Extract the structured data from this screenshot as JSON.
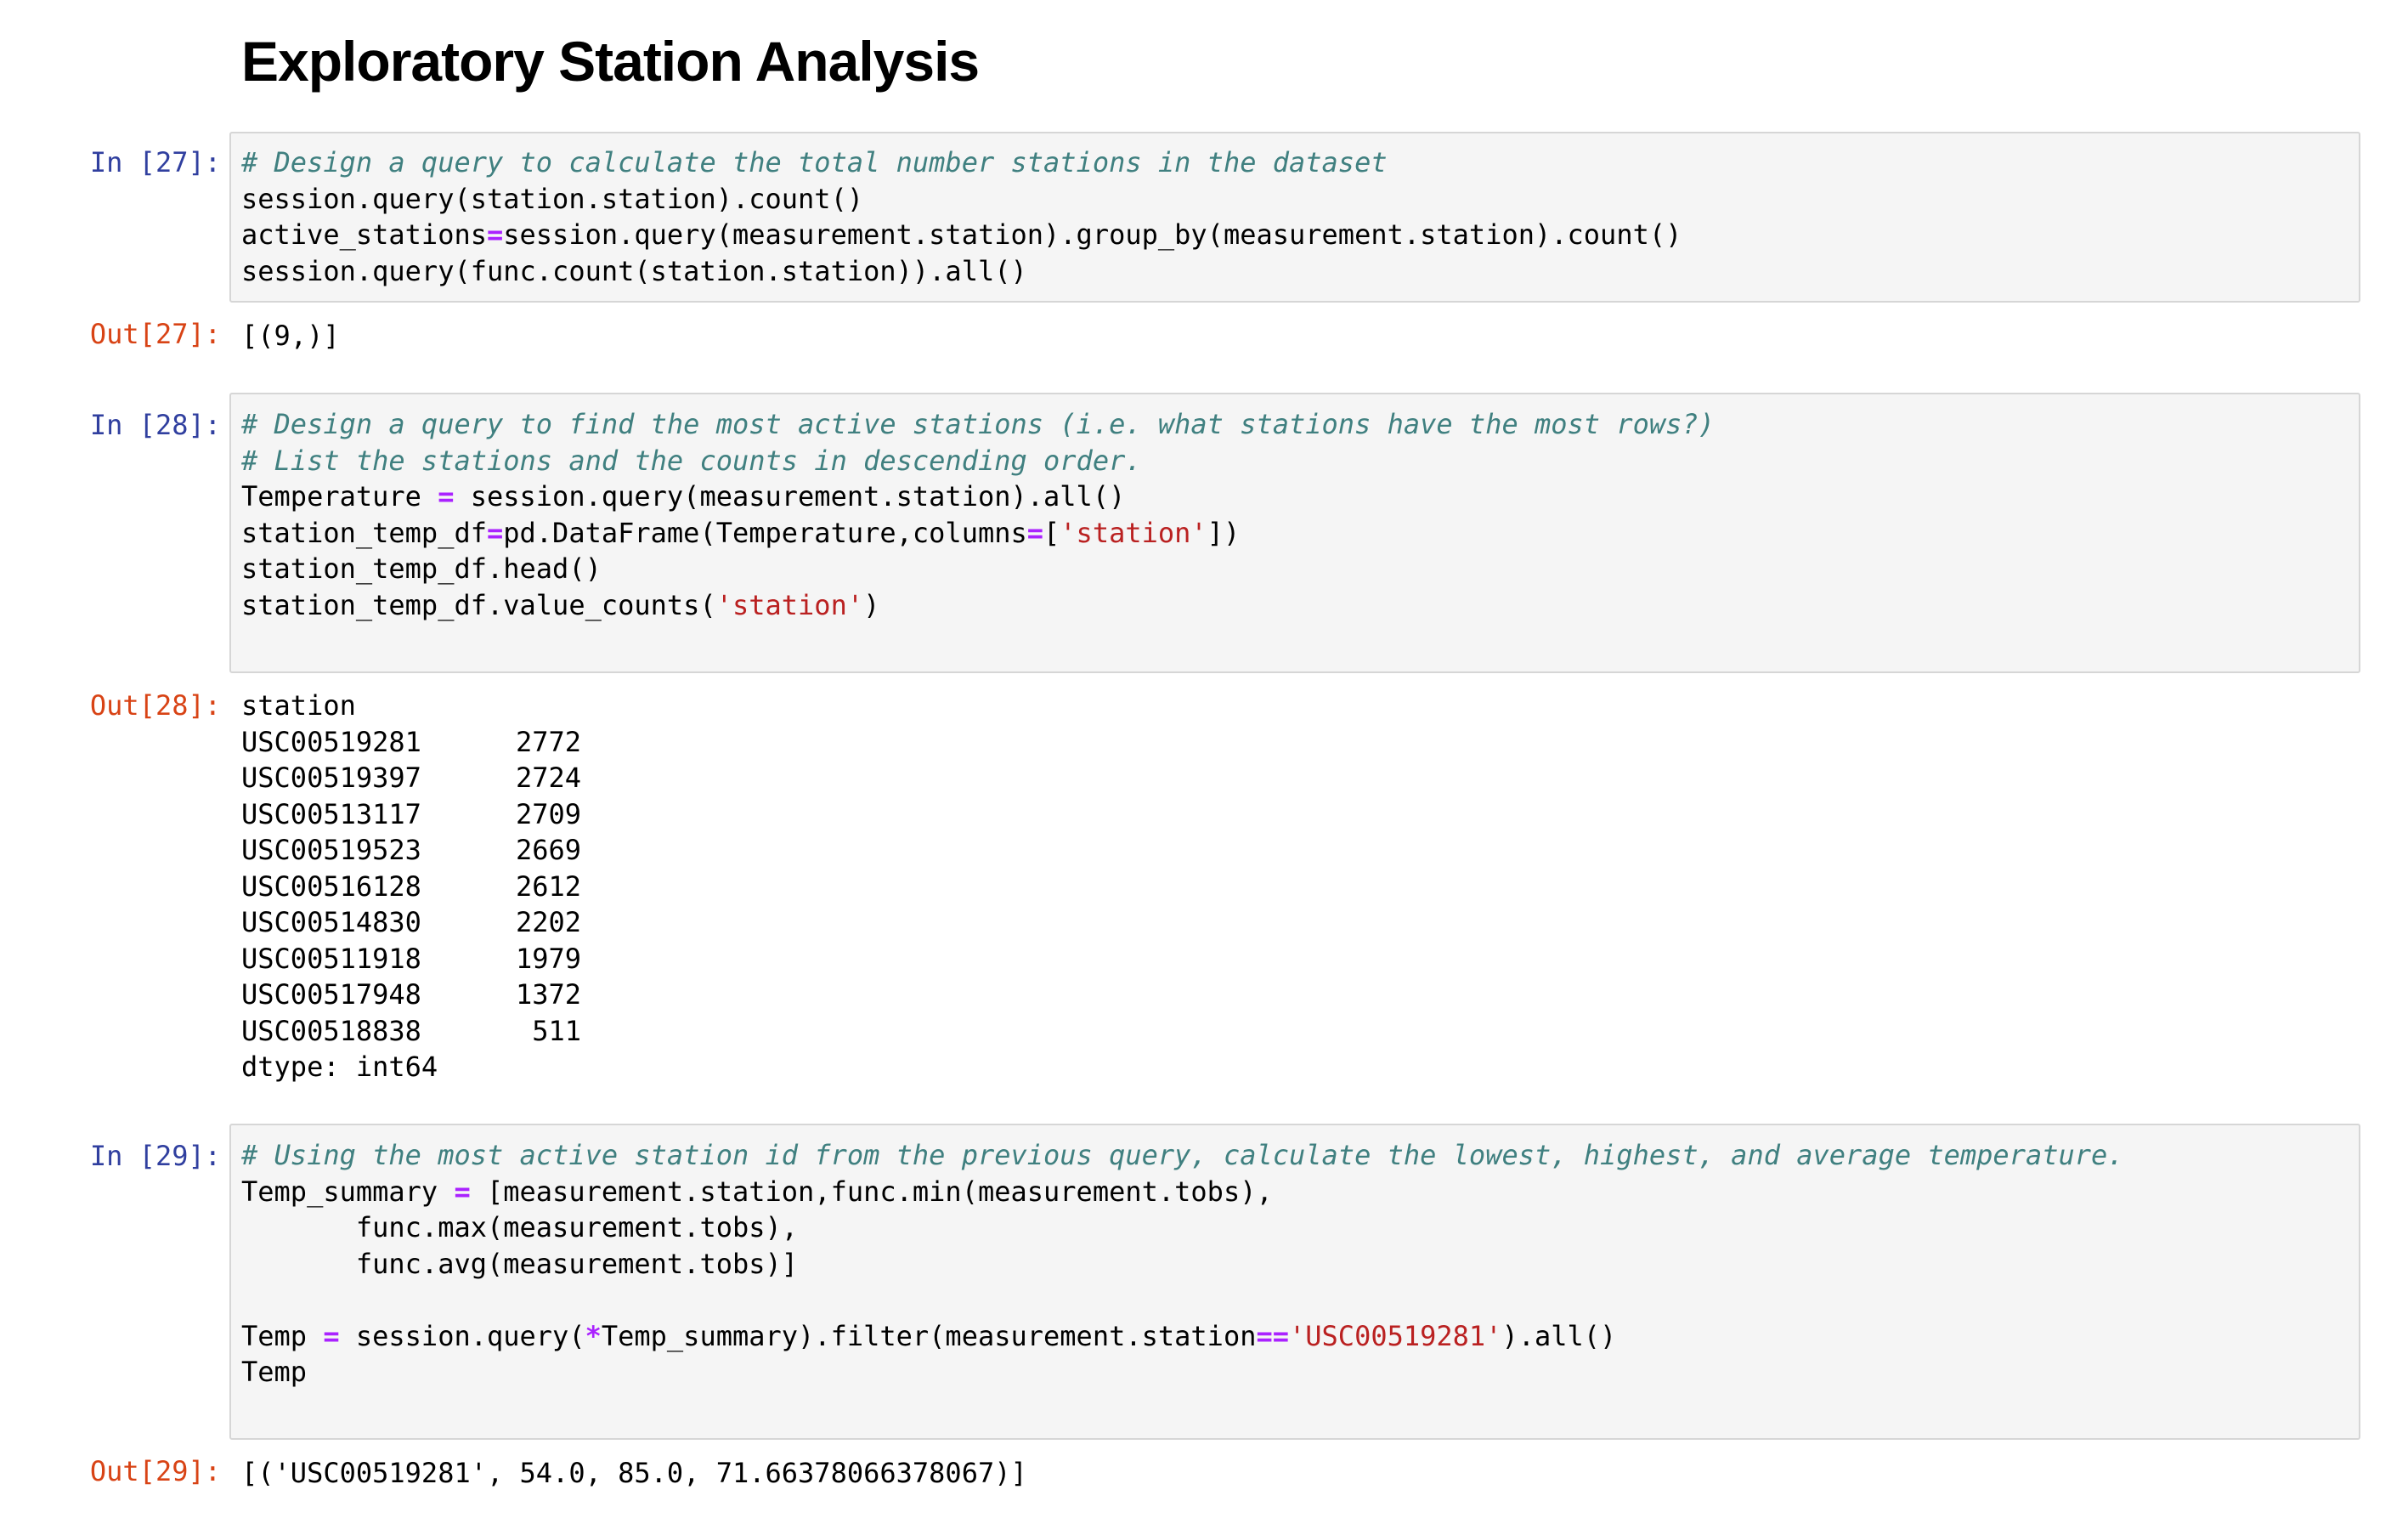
{
  "title": "Exploratory Station Analysis",
  "cells": [
    {
      "in_prompt": "In [27]:",
      "out_prompt": "Out[27]:",
      "code": {
        "l1_comment": "# Design a query to calculate the total number stations in the dataset",
        "l2": "session.query(station.station).count()",
        "l3_a": "active_stations",
        "l3_op": "=",
        "l3_b": "session.query(measurement.station).group_by(measurement.station).count()",
        "l4": "session.query(func.count(station.station)).all()"
      },
      "output": "[(9,)]"
    },
    {
      "in_prompt": "In [28]:",
      "out_prompt": "Out[28]:",
      "code": {
        "l1_comment": "# Design a query to find the most active stations (i.e. what stations have the most rows?)",
        "l2_comment": "# List the stations and the counts in descending order.",
        "l3_a": "Temperature ",
        "l3_op": "=",
        "l3_b": " session.query(measurement.station).all()",
        "l4_a": "station_temp_df",
        "l4_op1": "=",
        "l4_b": "pd.DataFrame(Temperature,columns",
        "l4_op2": "=",
        "l4_c": "[",
        "l4_str": "'station'",
        "l4_d": "])",
        "l5": "station_temp_df.head()",
        "l6_a": "station_temp_df.value_counts(",
        "l6_str": "'station'",
        "l6_b": ")"
      },
      "output": {
        "header": "station",
        "rows": [
          {
            "id": "USC00519281",
            "count": "2772"
          },
          {
            "id": "USC00519397",
            "count": "2724"
          },
          {
            "id": "USC00513117",
            "count": "2709"
          },
          {
            "id": "USC00519523",
            "count": "2669"
          },
          {
            "id": "USC00516128",
            "count": "2612"
          },
          {
            "id": "USC00514830",
            "count": "2202"
          },
          {
            "id": "USC00511918",
            "count": "1979"
          },
          {
            "id": "USC00517948",
            "count": "1372"
          },
          {
            "id": "USC00518838",
            "count": "511"
          }
        ],
        "dtype": "dtype: int64"
      }
    },
    {
      "in_prompt": "In [29]:",
      "out_prompt": "Out[29]:",
      "code": {
        "l1_comment": "# Using the most active station id from the previous query, calculate the lowest, highest, and average temperature.",
        "l2_a": "Temp_summary ",
        "l2_op": "=",
        "l2_b": " [measurement.station,func.min(measurement.tobs),",
        "l3": "       func.max(measurement.tobs),",
        "l4": "       func.avg(measurement.tobs)]",
        "l6_a": "Temp ",
        "l6_op1": "=",
        "l6_b": " session.query(",
        "l6_op2": "*",
        "l6_c": "Temp_summary).filter(measurement.station",
        "l6_op3": "==",
        "l6_str": "'USC00519281'",
        "l6_d": ").all()",
        "l7": "Temp"
      },
      "output": "[('USC00519281', 54.0, 85.0, 71.66378066378067)]"
    }
  ]
}
